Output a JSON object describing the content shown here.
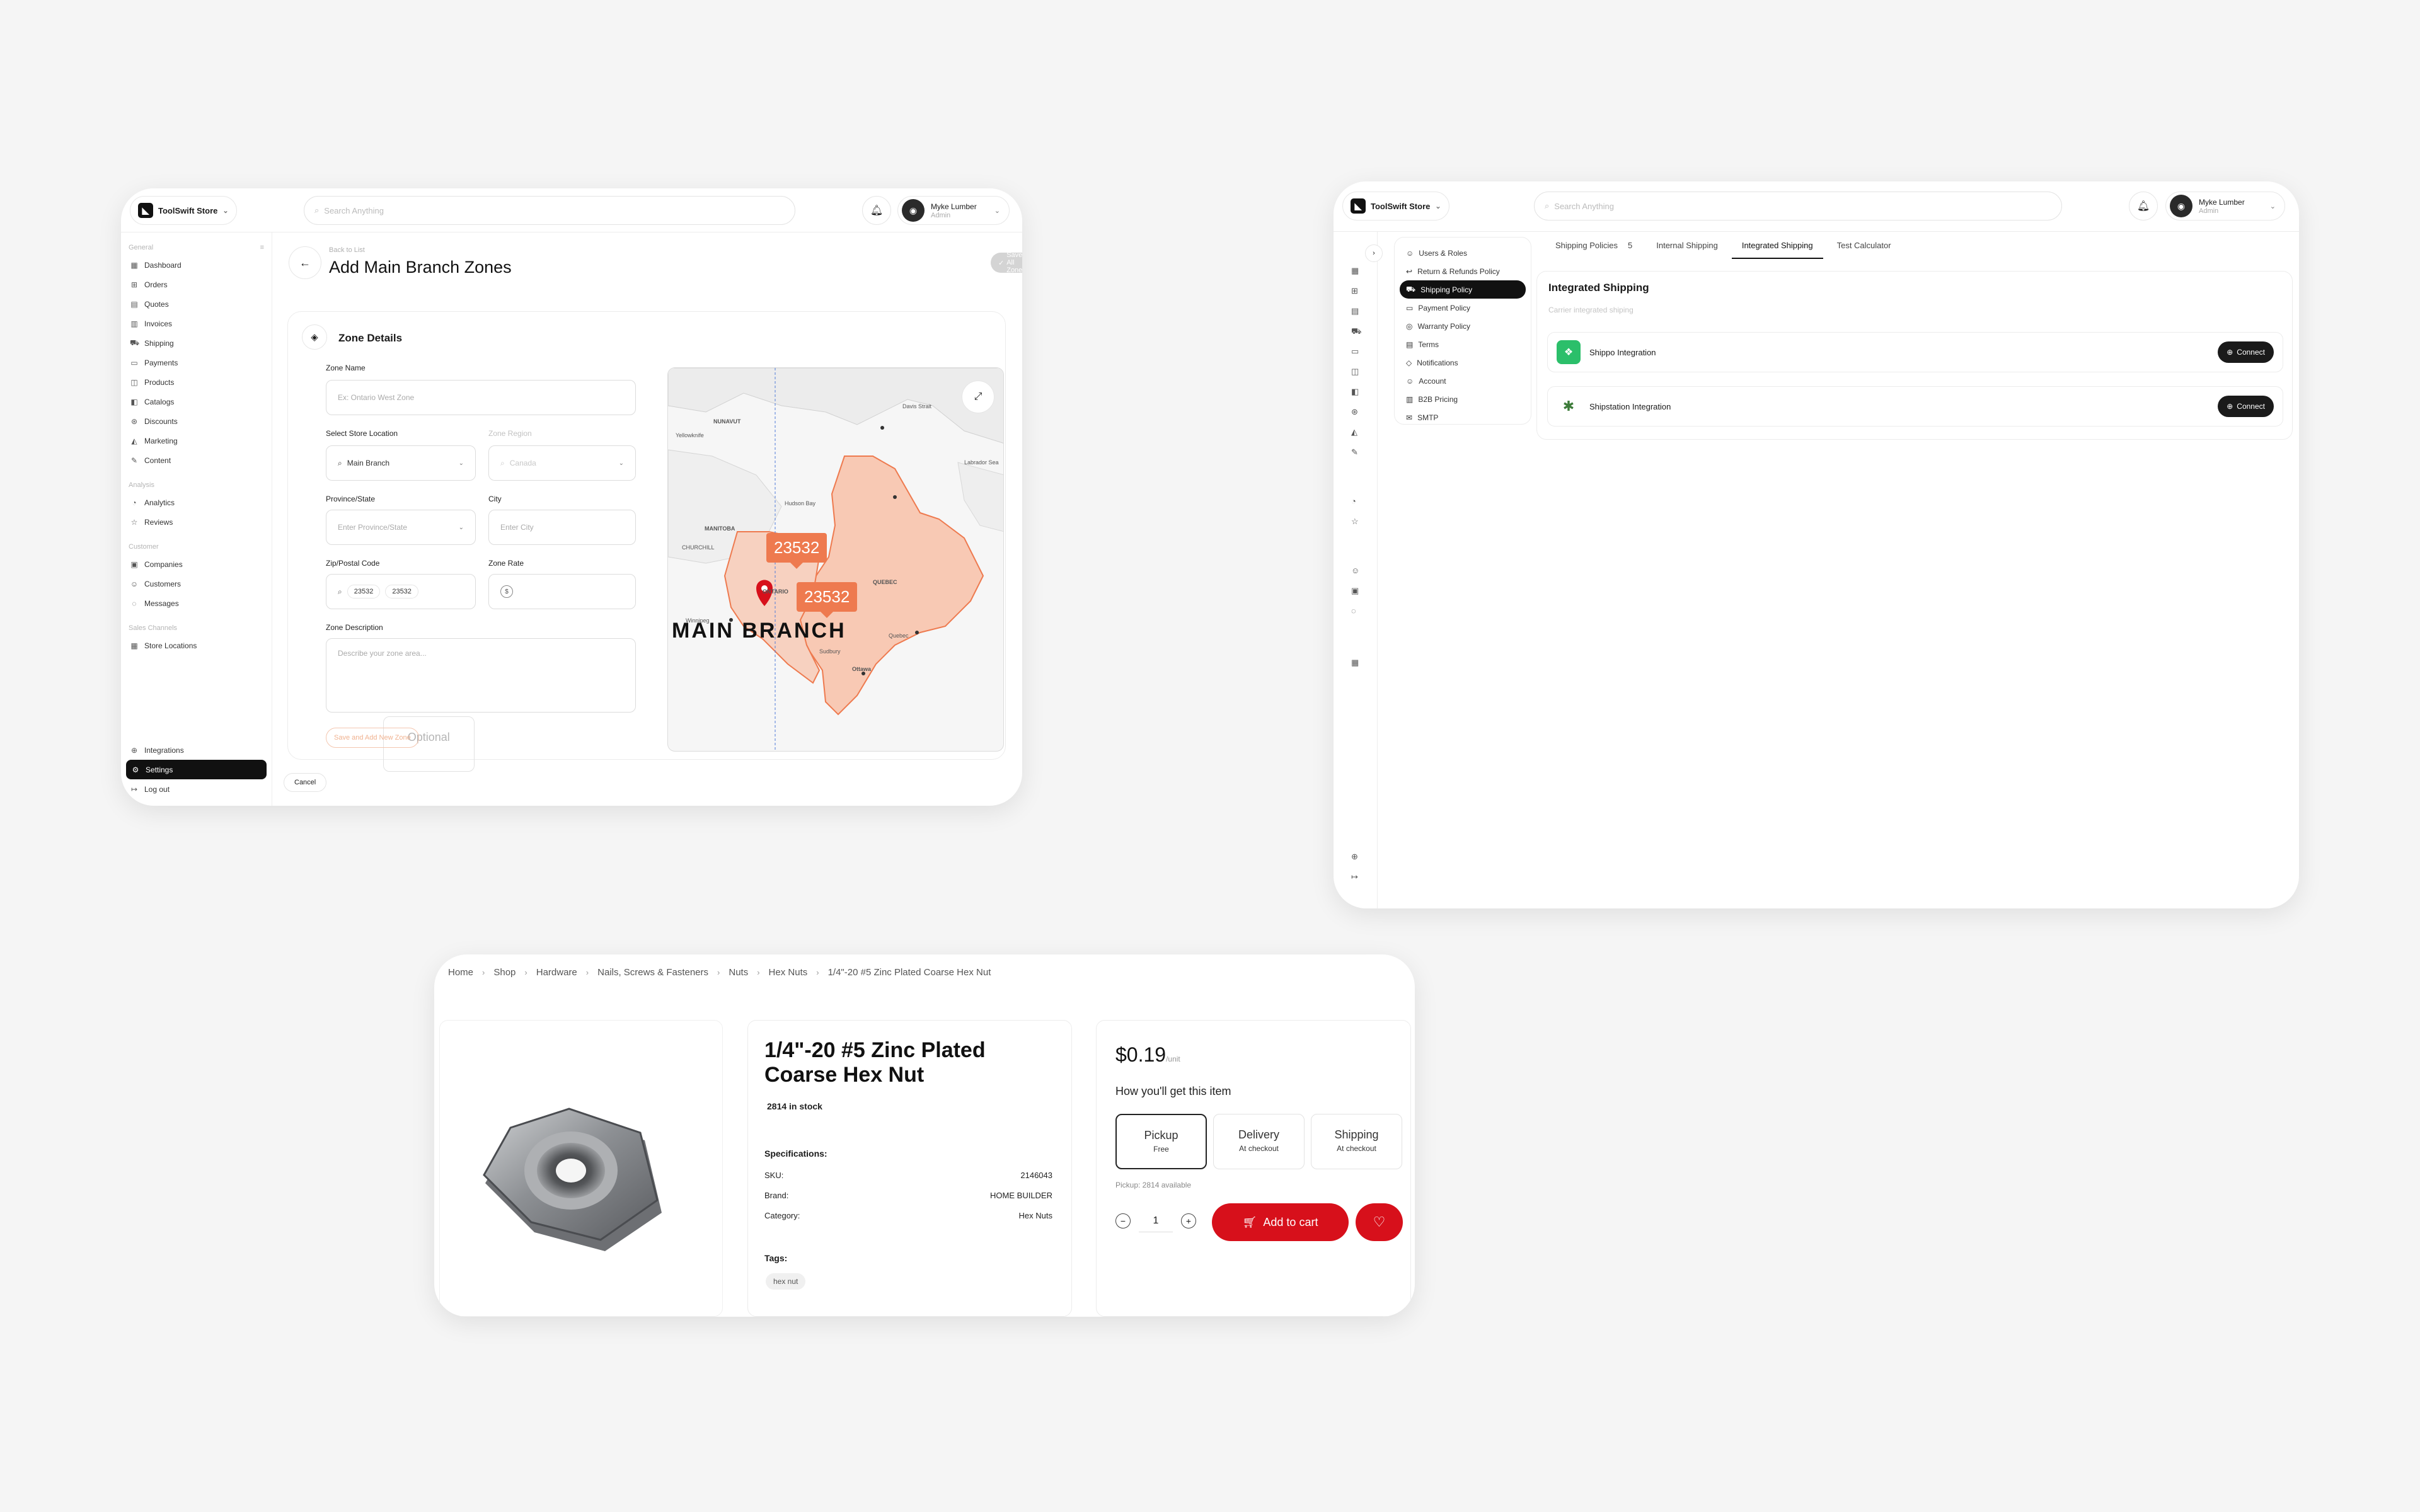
{
  "zones_screen": {
    "store_name": "ToolSwift Store",
    "search_placeholder": "Search Anything",
    "user": {
      "name": "Myke Lumber",
      "role": "Admin"
    },
    "sidebar": {
      "general_label": "General",
      "general_items": [
        "Dashboard",
        "Orders",
        "Quotes",
        "Invoices",
        "Shipping",
        "Payments",
        "Products",
        "Catalogs",
        "Discounts",
        "Marketing",
        "Content"
      ],
      "analysis_label": "Analysis",
      "analysis_items": [
        "Analytics",
        "Reviews"
      ],
      "customer_label": "Customer",
      "customer_items": [
        "Companies",
        "Customers",
        "Messages"
      ],
      "sales_label": "Sales Channels",
      "sales_items": [
        "Store Locations"
      ],
      "bottom_items": [
        "Integrations",
        "Settings",
        "Log out"
      ]
    },
    "back_label": "Back to List",
    "title": "Add Main Branch Zones",
    "save_all": "Save All Zones",
    "cancel": "Cancel",
    "section_title": "Zone Details",
    "zone_name_label": "Zone Name",
    "zone_name_placeholder": "Ex: Ontario West Zone",
    "store_location_label": "Select Store Location",
    "store_location_value": "Main Branch",
    "zone_region_label": "Zone Region",
    "zone_region_value": "Canada",
    "province_label": "Province/State",
    "province_placeholder": "Enter Province/State",
    "city_label": "City",
    "city_placeholder": "Enter City",
    "zip_label": "Zip/Postal Code",
    "zip_chips": [
      "23532",
      "23532"
    ],
    "zone_rate_label": "Zone Rate",
    "zone_rate_symbol": "$",
    "desc_label": "Zone Description",
    "desc_optional": "Optional",
    "desc_placeholder": "Describe your zone area...",
    "save_add": "Save and Add New Zone",
    "map": {
      "pins": [
        "23532",
        "23532"
      ],
      "labels": [
        "NUNAVUT",
        "MANITOBA",
        "ONTARIO",
        "QUEBEC",
        "Hudson Bay",
        "Labrador Sea",
        "Ottawa",
        "Quebec",
        "Winnipeg",
        "Yellowknife",
        "Davis Strait",
        "Sudbury",
        "CHURCHILL"
      ],
      "overlay_text": "MAIN BRANCH",
      "accent": "#ee7a4f"
    }
  },
  "shipping_screen": {
    "store_name": "ToolSwift Store",
    "search_placeholder": "Search Anything",
    "user": {
      "name": "Myke Lumber",
      "role": "Admin"
    },
    "menu": [
      "Users & Roles",
      "Return & Refunds Policy",
      "Shipping Policy",
      "Payment Policy",
      "Warranty Policy",
      "Terms",
      "Notifications",
      "Account",
      "B2B Pricing",
      "SMTP"
    ],
    "tabs": [
      "Shipping Policies",
      "Internal Shipping",
      "Integrated Shipping",
      "Test Calculator"
    ],
    "tab_count": "5",
    "section_title": "Integrated Shipping",
    "section_subtitle": "Carrier integrated shiping",
    "integrations": [
      {
        "name": "Shippo Integration",
        "action": "Connect",
        "color": "#2bbf6a"
      },
      {
        "name": "Shipstation Integration",
        "action": "Connect",
        "color": "#3d7c3a"
      }
    ]
  },
  "product_screen": {
    "breadcrumbs": [
      "Home",
      "Shop",
      "Hardware",
      "Nails, Screws & Fasteners",
      "Nuts",
      "Hex Nuts",
      "1/4\"-20 #5 Zinc Plated Coarse Hex Nut"
    ],
    "title": "1/4\"-20 #5 Zinc Plated Coarse Hex Nut",
    "stock": "2814 in stock",
    "spec_heading": "Specifications:",
    "specs": [
      {
        "k": "SKU:",
        "v": "2146043"
      },
      {
        "k": "Brand:",
        "v": "HOME BUILDER"
      },
      {
        "k": "Category:",
        "v": "Hex Nuts"
      }
    ],
    "tags_heading": "Tags:",
    "tags": [
      "hex nut"
    ],
    "price": "$0.19",
    "unit": "/unit",
    "how_label": "How you'll get this item",
    "options": [
      {
        "name": "Pickup",
        "sub": "Free"
      },
      {
        "name": "Delivery",
        "sub": "At checkout"
      },
      {
        "name": "Shipping",
        "sub": "At checkout"
      }
    ],
    "pickup_note": "Pickup: 2814 available",
    "quantity": "1",
    "add_to_cart": "Add to cart",
    "accent": "#d7101b"
  }
}
